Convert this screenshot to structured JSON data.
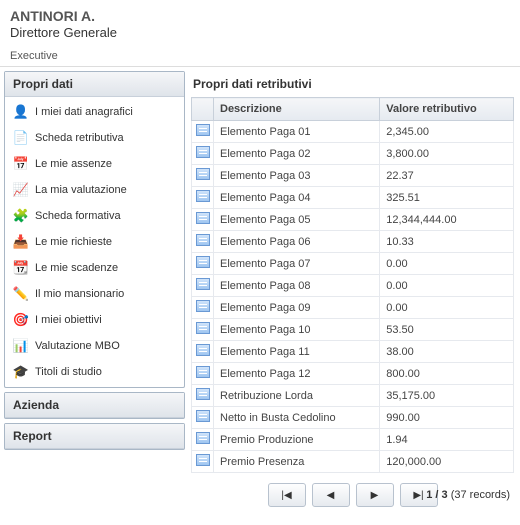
{
  "header": {
    "user_name": "ANTINORI A.",
    "user_role": "Direttore Generale"
  },
  "tabbar": {
    "active_tab": "Executive"
  },
  "sidebar": {
    "panels": [
      {
        "title": "Propri dati",
        "expanded": true,
        "items": [
          {
            "icon": "👤",
            "label": "I miei dati anagrafici",
            "name": "sidebar-item-anagrafici"
          },
          {
            "icon": "📄",
            "label": "Scheda retributiva",
            "name": "sidebar-item-scheda-retributiva"
          },
          {
            "icon": "📅",
            "label": "Le mie assenze",
            "name": "sidebar-item-assenze"
          },
          {
            "icon": "📈",
            "label": "La mia valutazione",
            "name": "sidebar-item-valutazione"
          },
          {
            "icon": "🧩",
            "label": "Scheda formativa",
            "name": "sidebar-item-formativa"
          },
          {
            "icon": "📥",
            "label": "Le mie richieste",
            "name": "sidebar-item-richieste"
          },
          {
            "icon": "📆",
            "label": "Le mie scadenze",
            "name": "sidebar-item-scadenze"
          },
          {
            "icon": "✏️",
            "label": "Il mio mansionario",
            "name": "sidebar-item-mansionario"
          },
          {
            "icon": "🎯",
            "label": "I miei obiettivi",
            "name": "sidebar-item-obiettivi"
          },
          {
            "icon": "📊",
            "label": "Valutazione MBO",
            "name": "sidebar-item-mbo"
          },
          {
            "icon": "🎓",
            "label": "Titoli di studio",
            "name": "sidebar-item-titoli"
          }
        ]
      },
      {
        "title": "Azienda",
        "expanded": false,
        "items": []
      },
      {
        "title": "Report",
        "expanded": false,
        "items": []
      }
    ]
  },
  "content": {
    "title": "Propri dati retributivi",
    "columns": {
      "descrizione": "Descrizione",
      "valore": "Valore retributivo"
    },
    "rows": [
      {
        "descrizione": "Elemento Paga 01",
        "valore": "2,345.00"
      },
      {
        "descrizione": "Elemento Paga 02",
        "valore": "3,800.00"
      },
      {
        "descrizione": "Elemento Paga 03",
        "valore": "22.37"
      },
      {
        "descrizione": "Elemento Paga 04",
        "valore": "325.51"
      },
      {
        "descrizione": "Elemento Paga 05",
        "valore": "12,344,444.00"
      },
      {
        "descrizione": "Elemento Paga 06",
        "valore": "10.33"
      },
      {
        "descrizione": "Elemento Paga 07",
        "valore": "0.00"
      },
      {
        "descrizione": "Elemento Paga 08",
        "valore": "0.00"
      },
      {
        "descrizione": "Elemento Paga 09",
        "valore": "0.00"
      },
      {
        "descrizione": "Elemento Paga 10",
        "valore": "53.50"
      },
      {
        "descrizione": "Elemento Paga 11",
        "valore": "38.00"
      },
      {
        "descrizione": "Elemento Paga 12",
        "valore": "800.00"
      },
      {
        "descrizione": "Retribuzione Lorda",
        "valore": "35,175.00"
      },
      {
        "descrizione": "Netto in Busta Cedolino",
        "valore": "990.00"
      },
      {
        "descrizione": "Premio Produzione",
        "valore": "1.94"
      },
      {
        "descrizione": "Premio Presenza",
        "valore": "120,000.00"
      }
    ],
    "pager": {
      "page": "1",
      "pages": "3",
      "records_label": "(37 records)"
    }
  }
}
